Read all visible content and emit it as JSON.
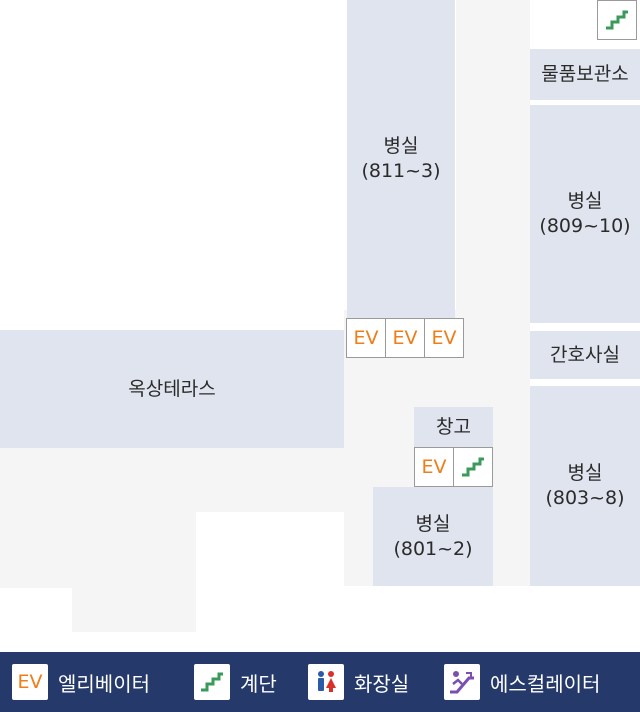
{
  "rooms": {
    "ward_811": {
      "name": "병실",
      "range": "(811~3)"
    },
    "storage_items": {
      "name": "물품보관소"
    },
    "ward_809": {
      "name": "병실",
      "range": "(809~10)"
    },
    "nurse_station": {
      "name": "간호사실"
    },
    "ward_803": {
      "name": "병실",
      "range": "(803~8)"
    },
    "rooftop_terrace": {
      "name": "옥상테라스"
    },
    "warehouse": {
      "name": "창고"
    },
    "ward_801": {
      "name": "병실",
      "range": "(801~2)"
    }
  },
  "markers": {
    "ev_label": "EV"
  },
  "legend": {
    "elevator": {
      "icon_text": "EV",
      "label": "엘리베이터"
    },
    "stairs": {
      "label": "계단"
    },
    "restroom": {
      "label": "화장실"
    },
    "escalator": {
      "label": "에스컬레이터"
    }
  },
  "colors": {
    "room": "#dfe4ee",
    "floor": "#f5f5f5",
    "legend_bg": "#253a6a",
    "ev_text": "#ef7d18",
    "stairs": "#3a9a5a",
    "restroom_male": "#2a5aa8",
    "restroom_female": "#d9302b",
    "escalator": "#7a4fb0"
  }
}
